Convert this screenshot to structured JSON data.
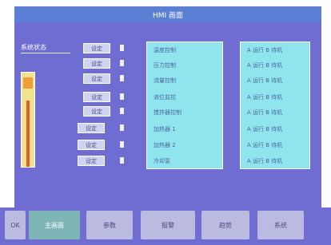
{
  "window": {
    "title": "HMI 画面"
  },
  "main": {
    "top_label": "系统状态",
    "rows": [
      {
        "button": "设定",
        "name": "温度控制",
        "value": "A 运行  B 待机"
      },
      {
        "button": "设定",
        "name": "压力控制",
        "value": "A 运行  B 待机"
      },
      {
        "button": "设定",
        "name": "流量控制",
        "value": "A 运行  B 待机"
      },
      {
        "button": "设定",
        "name": "液位监控",
        "value": "A 运行  B 待机"
      },
      {
        "button": "设定",
        "name": "搅拌器控制",
        "value": "A 运行  B 待机"
      },
      {
        "button": "设定",
        "name": "加热器 1",
        "value": "A 运行  B 待机"
      },
      {
        "button": "设定",
        "name": "加热器 2",
        "value": "A 运行  B 待机"
      },
      {
        "button": "设定",
        "name": "冷却泵",
        "value": "A 运行  B 待机"
      }
    ],
    "level_percent": 70
  },
  "footer": {
    "tabs": [
      {
        "label": "OK"
      },
      {
        "label": "主画面"
      },
      {
        "label": "参数"
      },
      {
        "label": "报警"
      },
      {
        "label": "趋势"
      },
      {
        "label": "系统"
      }
    ]
  },
  "colors": {
    "title_bar": "#5a7fd4",
    "panel": "#6f6dd1",
    "list_bg": "#90e4ee",
    "active_tab": "#7eb5b6"
  }
}
